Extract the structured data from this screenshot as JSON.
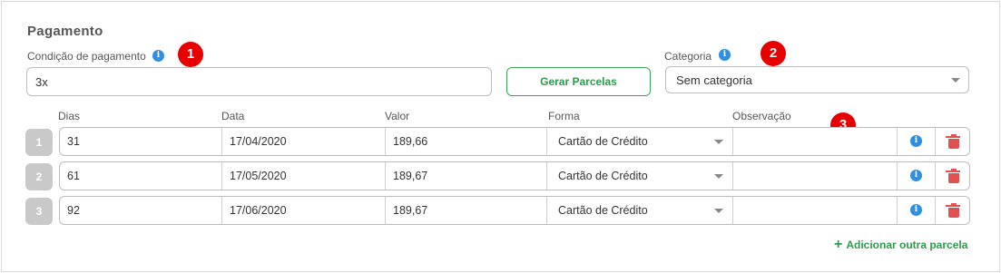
{
  "section": {
    "title": "Pagamento"
  },
  "condicao": {
    "label": "Condição de pagamento",
    "value": "3x"
  },
  "gerar_button": {
    "label": "Gerar Parcelas"
  },
  "categoria": {
    "label": "Categoria",
    "value": "Sem categoria"
  },
  "badges": [
    "1",
    "2",
    "3"
  ],
  "columns": {
    "dias": "Dias",
    "data": "Data",
    "valor": "Valor",
    "forma": "Forma",
    "observacao": "Observação"
  },
  "rows": [
    {
      "num": "1",
      "dias": "31",
      "data": "17/04/2020",
      "valor": "189,66",
      "forma": "Cartão de Crédito",
      "observacao": ""
    },
    {
      "num": "2",
      "dias": "61",
      "data": "17/05/2020",
      "valor": "189,67",
      "forma": "Cartão de Crédito",
      "observacao": ""
    },
    {
      "num": "3",
      "dias": "92",
      "data": "17/06/2020",
      "valor": "189,67",
      "forma": "Cartão de Crédito",
      "observacao": ""
    }
  ],
  "add_link": {
    "plus": "+",
    "label": "Adicionar outra parcela"
  },
  "icons": {
    "info": "info-icon",
    "trash": "trash-icon",
    "dropdown": "chevron-down-icon"
  },
  "colors": {
    "accent_green": "#2e9a4a",
    "info_blue": "#2f8fe0",
    "trash_red": "#e05252",
    "badge_red": "#e60000"
  }
}
